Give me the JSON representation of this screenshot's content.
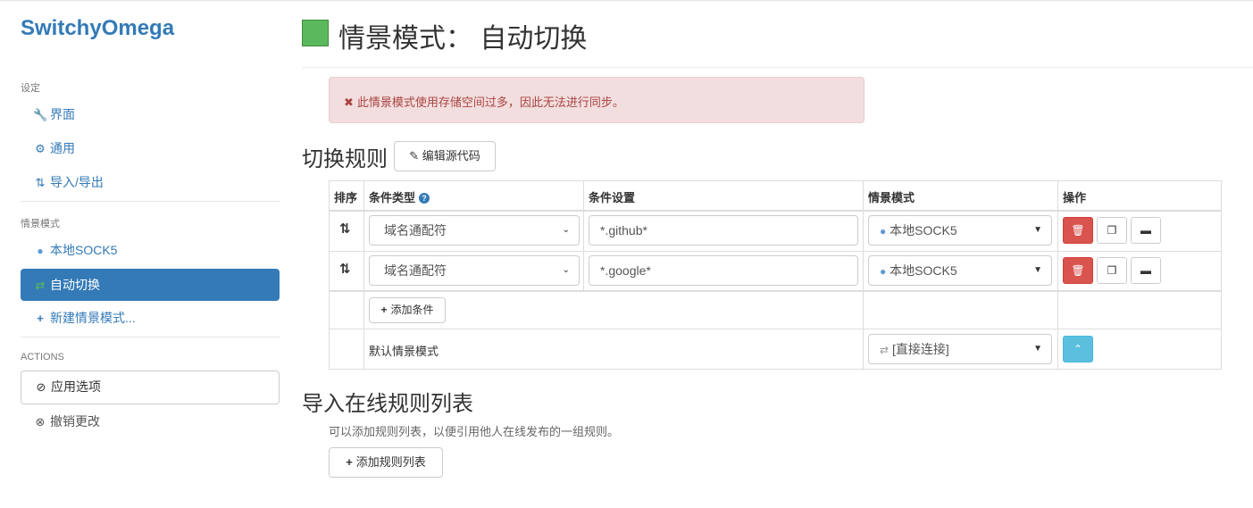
{
  "app": {
    "brand": "SwitchyOmega"
  },
  "sidebar": {
    "settings_header": "设定",
    "settings_items": [
      {
        "label": "界面",
        "icon": "wrench-icon"
      },
      {
        "label": "通用",
        "icon": "gear-icon"
      },
      {
        "label": "导入/导出",
        "icon": "import-export-icon"
      }
    ],
    "profiles_header": "情景模式",
    "profile_items": [
      {
        "label": "本地SOCK5",
        "icon": "globe-icon"
      },
      {
        "label": "自动切换",
        "icon": "retweet-icon"
      },
      {
        "label": "新建情景模式...",
        "icon": "plus-icon"
      }
    ],
    "actions_header": "ACTIONS",
    "apply_label": "应用选项",
    "discard_label": "撤销更改"
  },
  "page": {
    "title": "情景模式： 自动切换",
    "profile_color": "#5cb85c"
  },
  "alert": {
    "message": "此情景模式使用存储空间过多，因此无法进行同步。"
  },
  "rules_section": {
    "title": "切换规则",
    "edit_source_label": "编辑源代码",
    "headers": {
      "sort": "排序",
      "condition_type": "条件类型",
      "condition": "条件设置",
      "profile": "情景模式",
      "actions": "操作"
    },
    "rows": [
      {
        "condition_type": "域名通配符",
        "condition": "*.github*",
        "profile": "本地SOCK5"
      },
      {
        "condition_type": "域名通配符",
        "condition": "*.google*",
        "profile": "本地SOCK5"
      }
    ],
    "add_condition_label": "添加条件",
    "default_label": "默认情景模式",
    "default_profile": "[直接连接]"
  },
  "rulelist_section": {
    "title": "导入在线规则列表",
    "description": "可以添加规则列表，以便引用他人在线发布的一组规则。",
    "add_label": "添加规则列表"
  }
}
